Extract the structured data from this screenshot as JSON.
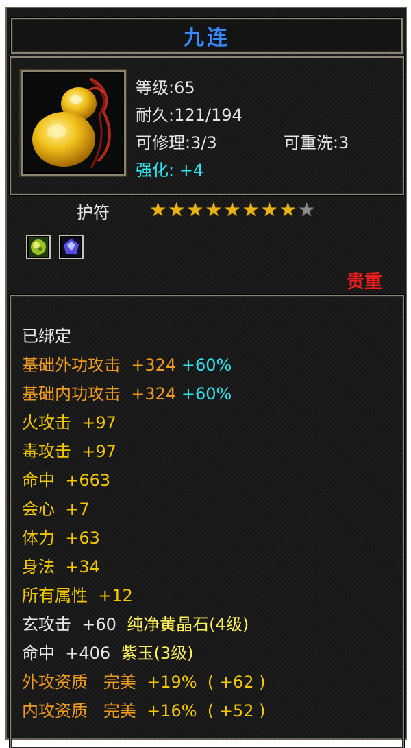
{
  "item": {
    "name": "九连",
    "level": "等级:65",
    "durability": "耐久:121/194",
    "repair": "可修理:3/3",
    "rewash": "可重洗:3",
    "enhance": "强化: +4",
    "category": "护符",
    "stars": {
      "filled": 8,
      "total": 9
    },
    "rarity": "贵重"
  },
  "gems": [
    {
      "icon": "green-yellow-gem-icon",
      "color": "#9bbf2a"
    },
    {
      "icon": "purple-gem-icon",
      "color": "#5a4be0"
    }
  ],
  "properties": {
    "bound": "已绑定",
    "ext_attack": {
      "label": "基础外功攻击",
      "value": "+324",
      "pct": "+60%"
    },
    "int_attack": {
      "label": "基础内功攻击",
      "value": "+324",
      "pct": "+60%"
    },
    "fire_attack": {
      "label": "火攻击",
      "value": "+97"
    },
    "poison_attack": {
      "label": "毒攻击",
      "value": "+97"
    },
    "hit": {
      "label": "命中",
      "value": "+663"
    },
    "crit": {
      "label": "会心",
      "value": "+7"
    },
    "stamina": {
      "label": "体力",
      "value": "+63"
    },
    "agility": {
      "label": "身法",
      "value": "+34"
    },
    "all_attr": {
      "label": "所有属性",
      "value": "+12"
    },
    "mystic_attack": {
      "label": "玄攻击",
      "value": "+60",
      "gem": "纯净黄晶石(4级)"
    },
    "hit_gem": {
      "label": "命中",
      "value": "+406",
      "gem": "紫玉(3级)"
    },
    "ext_quality": {
      "label": "外攻资质",
      "grade": "完美",
      "pct": "+19%",
      "bonus": "( +62 )"
    },
    "int_quality": {
      "label": "内攻资质",
      "grade": "完美",
      "pct": "+16%",
      "bonus": "( +52 )"
    }
  }
}
